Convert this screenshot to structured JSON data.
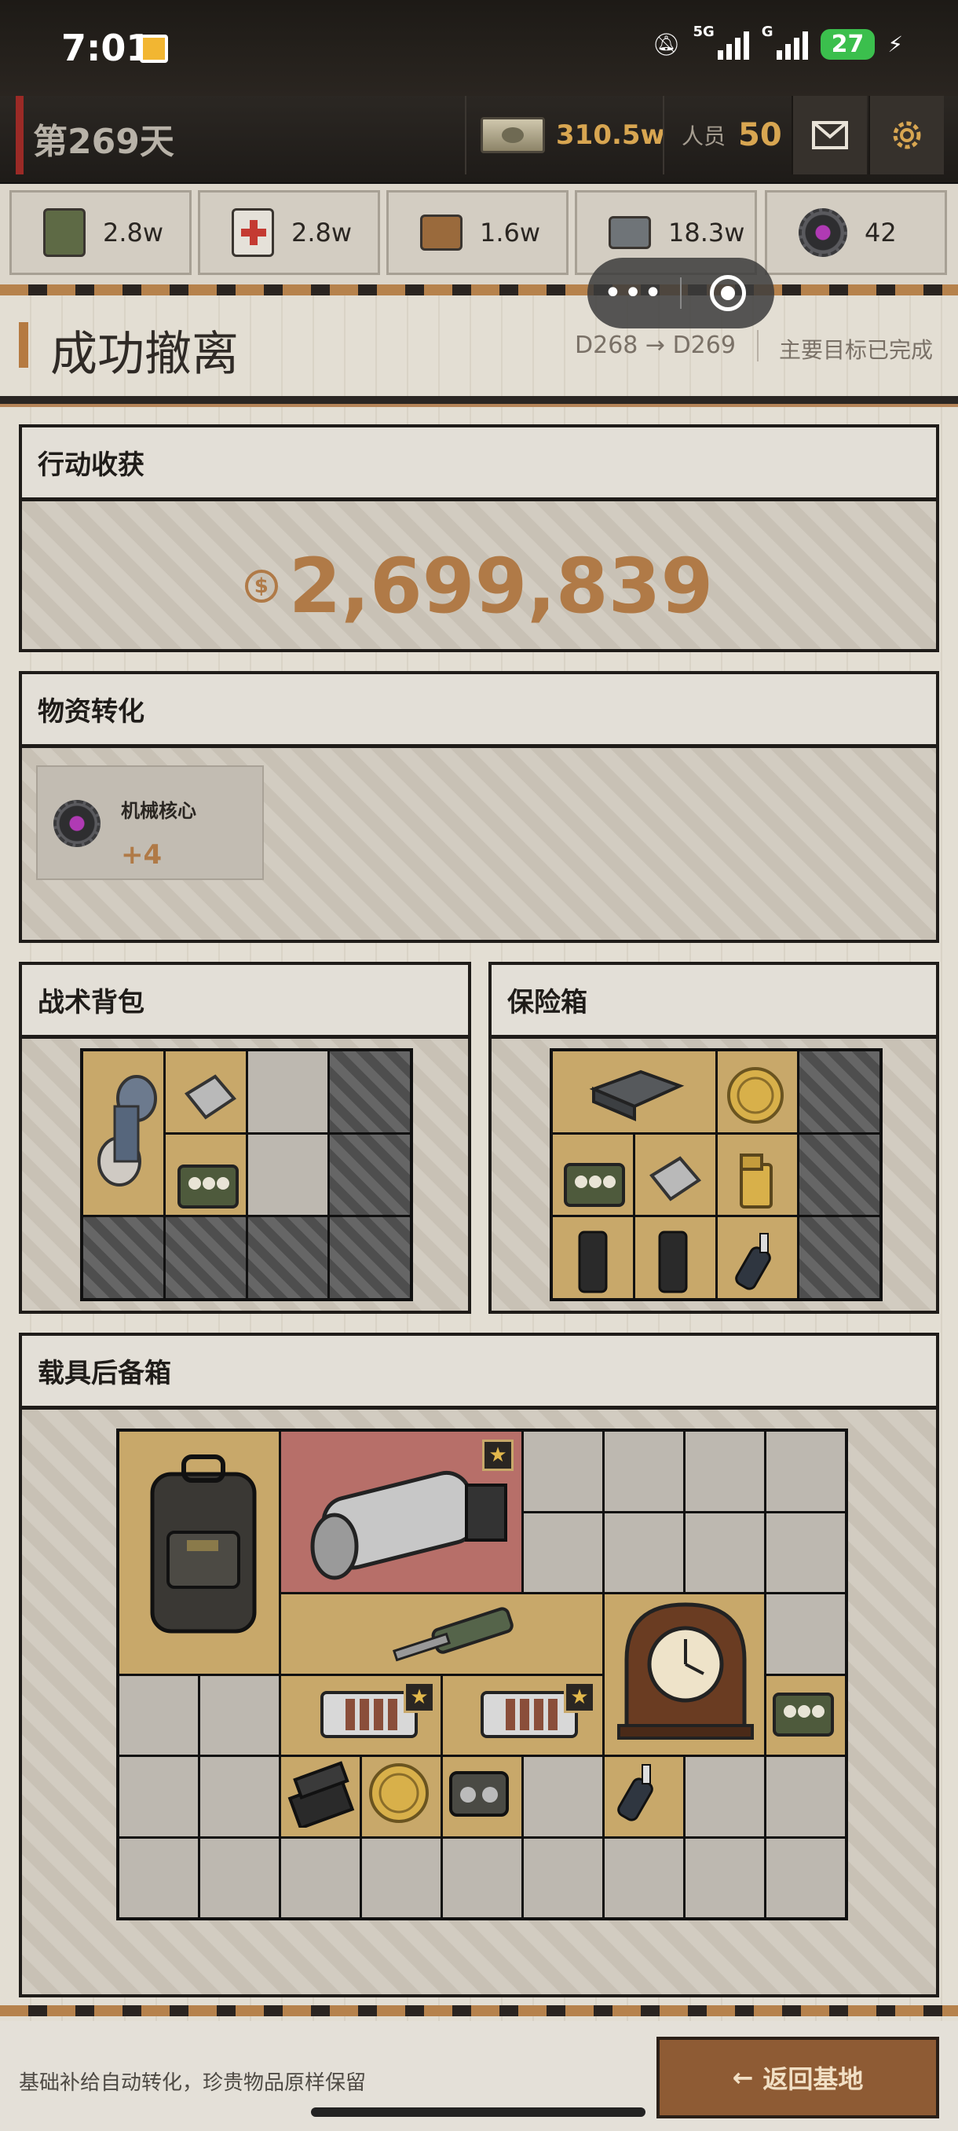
{
  "status": {
    "time": "7:01",
    "net1": "5G",
    "net2": "G",
    "battery": "27"
  },
  "header": {
    "day": "第269天",
    "cash": "310.5w",
    "crew_label": "人员",
    "crew_value": "50",
    "icons": [
      "mail-icon",
      "gear-icon"
    ]
  },
  "resources": [
    {
      "icon": "wheat-can-icon",
      "value": "2.8w"
    },
    {
      "icon": "medkit-icon",
      "value": "2.8w"
    },
    {
      "icon": "wood-icon",
      "value": "1.6w"
    },
    {
      "icon": "metal-icon",
      "value": "18.3w"
    },
    {
      "icon": "mech-core-icon",
      "value": "42"
    }
  ],
  "capsule": {
    "more": "•••"
  },
  "result": {
    "title": "成功撤离",
    "route": "D268 → D269",
    "objective": "主要目标已完成"
  },
  "gain": {
    "title": "行动收获",
    "currency_symbol": "$",
    "amount": "2,699,839"
  },
  "conversion": {
    "title": "物资转化",
    "items": [
      {
        "name": "机械核心",
        "qty": "+4"
      }
    ]
  },
  "backpack": {
    "title": "战术背包"
  },
  "safe": {
    "title": "保险箱"
  },
  "trunk": {
    "title": "载具后备箱"
  },
  "footer": {
    "note": "基础补给自动转化，珍贵物品原样保留",
    "back_label": "返回基地",
    "back_arrow": "←"
  },
  "colors": {
    "accent": "#b07a47",
    "gold_cell": "#c8a86a",
    "rare_cell": "#b76f69",
    "hazard_stripe": "#b6824c"
  }
}
